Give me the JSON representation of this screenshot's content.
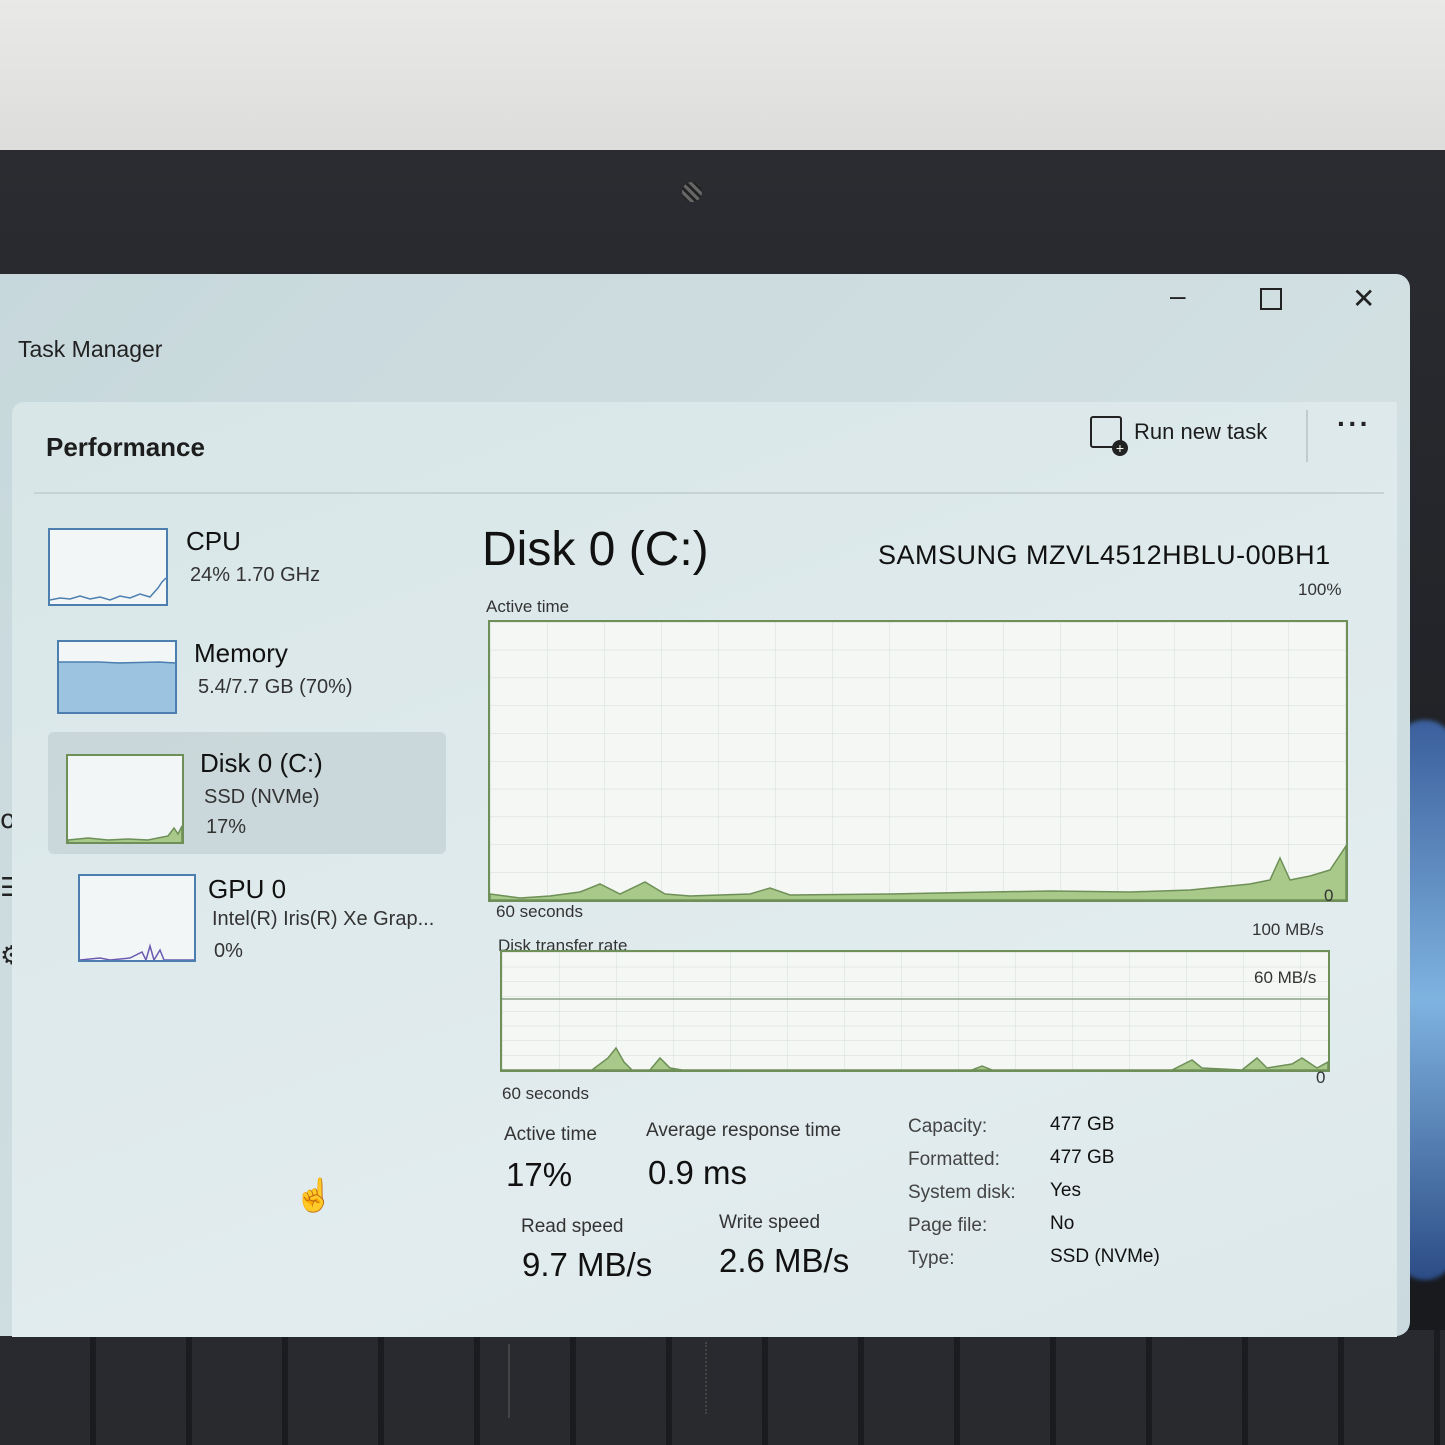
{
  "window": {
    "title": "Task Manager",
    "minimize_icon": "minimize-icon",
    "maximize_icon": "maximize-icon",
    "close_icon": "close-icon"
  },
  "page": {
    "title": "Performance",
    "run_new_task": "Run new task",
    "more_icon": "more-icon"
  },
  "devices": [
    {
      "name": "CPU",
      "line1": "24%  1.70 GHz",
      "line2": ""
    },
    {
      "name": "Memory",
      "line1": "5.4/7.7 GB (70%)",
      "line2": ""
    },
    {
      "name": "Disk 0 (C:)",
      "line1": "SSD (NVMe)",
      "line2": "17%"
    },
    {
      "name": "GPU 0",
      "line1": "Intel(R) Iris(R) Xe Grap...",
      "line2": "0%"
    }
  ],
  "detail": {
    "title": "Disk 0 (C:)",
    "model": "SAMSUNG MZVL4512HBLU-00BH1",
    "active_chart": {
      "label": "Active time",
      "max": "100%",
      "min": "0",
      "time": "60 seconds"
    },
    "transfer_chart": {
      "label": "Disk transfer rate",
      "max": "100 MB/s",
      "mid": "60 MB/s",
      "min": "0",
      "time": "60 seconds"
    },
    "stats": {
      "active_time_label": "Active time",
      "active_time": "17%",
      "avg_resp_label": "Average response time",
      "avg_resp": "0.9 ms",
      "read_label": "Read speed",
      "read": "9.7 MB/s",
      "write_label": "Write speed",
      "write": "2.6 MB/s"
    },
    "props": [
      {
        "k": "Capacity:",
        "v": "477 GB"
      },
      {
        "k": "Formatted:",
        "v": "477 GB"
      },
      {
        "k": "System disk:",
        "v": "Yes"
      },
      {
        "k": "Page file:",
        "v": "No"
      },
      {
        "k": "Type:",
        "v": "SSD (NVMe)"
      }
    ]
  },
  "colors": {
    "accent_disk": "#6e8f57",
    "accent_cpu": "#4c7fb0",
    "fill_disk": "#a9c98a"
  }
}
